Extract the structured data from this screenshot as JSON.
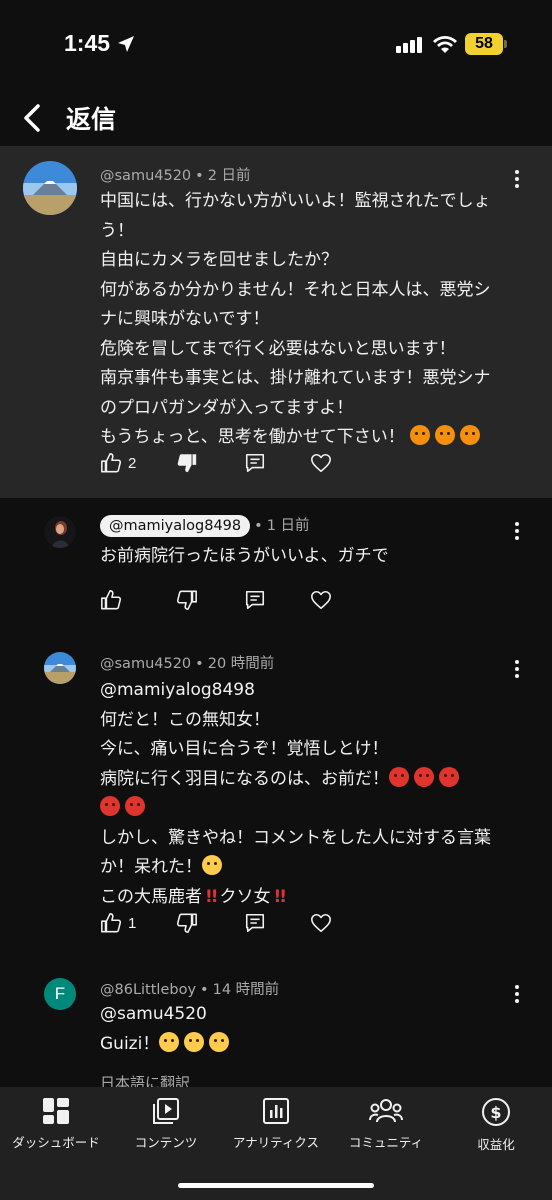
{
  "status_bar": {
    "time": "1:45",
    "battery": "58",
    "icons": [
      "location-arrow-icon",
      "cellular-signal-icon",
      "wifi-icon",
      "battery-icon"
    ]
  },
  "header": {
    "title": "返信",
    "back_icon": "chevron-left-icon"
  },
  "comments": [
    {
      "handle": "@samu4520",
      "age": "2 日前",
      "lines": [
        "中国には、行かない方がいいよ！監視されたでしょ",
        "う！",
        "自由にカメラを回せましたか？",
        "何があるか分かりません！それと日本人は、悪党シ",
        "ナに興味がないです！",
        "危険を冒してまで行く必要はないと思います！",
        "南京事件も事実とは、掛け離れています！悪党シナ",
        "のプロパガンダが入ってますよ！",
        "もうちょっと、思考を働かせて下さい！"
      ],
      "like_count": "2"
    },
    {
      "handle": "@mamiyalog8498",
      "age": "1 日前",
      "lines": [
        "お前病院行ったほうがいいよ、ガチで"
      ],
      "like_count": ""
    },
    {
      "handle": "@samu4520",
      "age": "20 時間前",
      "lines": [
        "@mamiyalog8498",
        "何だと！この無知女！",
        "今に、痛い目に合うぞ！覚悟しとけ！",
        "病院に行く羽目になるのは、お前だ！",
        "",
        "しかし、驚きやね！コメントをした人に対する言葉",
        "か！呆れた！",
        "この大馬鹿者",
        "クソ女"
      ],
      "like_count": "1"
    },
    {
      "handle": "@86Littleboy",
      "age": "14 時間前",
      "avatar_letter": "F",
      "lines": [
        "@samu4520",
        "Guizi！"
      ],
      "like_count": ""
    }
  ],
  "translate_label": "日本語に翻訳",
  "colors": {
    "background": "#0f0f0f",
    "highlight": "#272727",
    "nav": "#212121",
    "battery": "#f2d12e",
    "avatar_f": "#00897b"
  },
  "bottom_nav": [
    {
      "label": "ダッシュボード",
      "icon": "dashboard-icon"
    },
    {
      "label": "コンテンツ",
      "icon": "content-icon"
    },
    {
      "label": "アナリティクス",
      "icon": "analytics-icon"
    },
    {
      "label": "コミュニティ",
      "icon": "community-icon"
    },
    {
      "label": "収益化",
      "icon": "dollar-icon"
    }
  ]
}
